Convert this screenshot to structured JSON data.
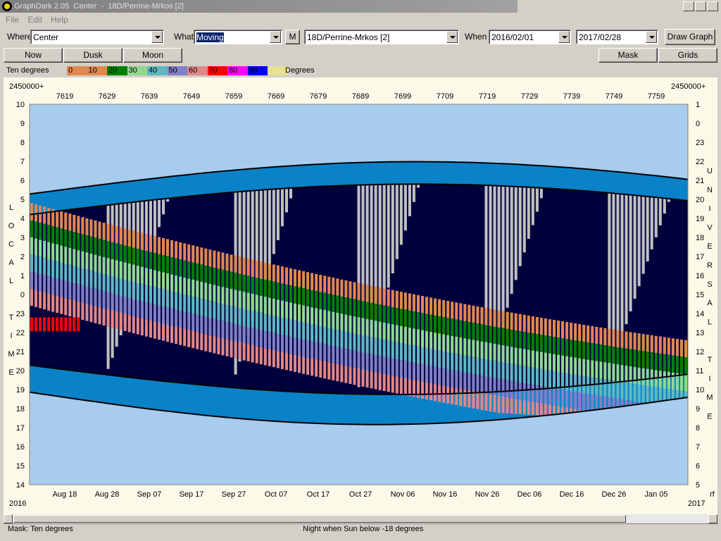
{
  "window": {
    "title": "GraphDark 2.05  Center  -  18D/Perrine-Mrkos [2]",
    "controls": [
      "_",
      "❐",
      "✕"
    ]
  },
  "menu": {
    "items": [
      "File",
      "Edit",
      "Help"
    ]
  },
  "toolbar": {
    "where_label": "Where",
    "where_value": "Center",
    "what_label": "What",
    "what_value": "Moving",
    "m_button": "M",
    "object_value": "18D/Perrine-Mrkos [2]",
    "when_label": "When",
    "start_date": "2016/02/01",
    "end_date": "2017/02/28",
    "draw_button": "Draw Graph"
  },
  "toolbar2": {
    "now": "Now",
    "dusk": "Dusk",
    "moon": "Moon",
    "mask": "Mask",
    "grids": "Grids"
  },
  "legend": {
    "label": "Ten degrees",
    "unit": "Degrees",
    "entries": [
      {
        "text": "0",
        "color": "#e08850"
      },
      {
        "text": "10",
        "color": "#e08850"
      },
      {
        "text": "20",
        "color": "#008000"
      },
      {
        "text": "30",
        "color": "#90d890"
      },
      {
        "text": "40",
        "color": "#60b8c0"
      },
      {
        "text": "50",
        "color": "#8080c8"
      },
      {
        "text": "60",
        "color": "#e08888"
      },
      {
        "text": "70",
        "color": "#ff0000"
      },
      {
        "text": "80",
        "color": "#ff00ff"
      },
      {
        "text": "90",
        "color": "#0000ff"
      },
      {
        "text": "",
        "color": "#e8e090"
      }
    ]
  },
  "graph": {
    "jd_prefix_left": "2450000+",
    "jd_prefix_right": "2450000+",
    "jd_ticks": [
      "7619",
      "7629",
      "7639",
      "7649",
      "7659",
      "7669",
      "7679",
      "7689",
      "7699",
      "7709",
      "7719",
      "7729",
      "7739",
      "7749",
      "7759"
    ],
    "date_ticks": [
      "Aug 18",
      "Aug 28",
      "Sep 07",
      "Sep 17",
      "Sep 27",
      "Oct 07",
      "Oct 17",
      "Oct 27",
      "Nov 06",
      "Nov 16",
      "Nov 26",
      "Dec 06",
      "Dec 16",
      "Dec 26",
      "Jan 05"
    ],
    "year_left": "2016",
    "year_right": "2017",
    "corner_right": "rf",
    "local_hours": [
      "10",
      "9",
      "8",
      "7",
      "6",
      "5",
      "4",
      "3",
      "2",
      "1",
      "0",
      "23",
      "22",
      "21",
      "20",
      "19",
      "18",
      "17",
      "16",
      "15",
      "14"
    ],
    "ut_hours": [
      "1",
      "0",
      "23",
      "22",
      "21",
      "20",
      "19",
      "18",
      "17",
      "16",
      "15",
      "14",
      "13",
      "12",
      "11",
      "10",
      "9",
      "8",
      "7",
      "6",
      "5"
    ],
    "local_label": [
      "L",
      "O",
      "C",
      "A",
      "L",
      "",
      "T",
      "I",
      "M",
      "E"
    ],
    "ut_label": [
      "U",
      "N",
      "I",
      "V",
      "E",
      "R",
      "S",
      "A",
      "L",
      "",
      "T",
      "I",
      "M",
      "E"
    ],
    "colors": {
      "day": "#a8ccee",
      "twilight": "#0a82c8",
      "night": "#00003c",
      "moon": "#c0c0c0",
      "boundary": "#000000"
    }
  },
  "status": {
    "left": "Mask:  Ten degrees",
    "center": "Night when Sun below -18 degrees"
  }
}
